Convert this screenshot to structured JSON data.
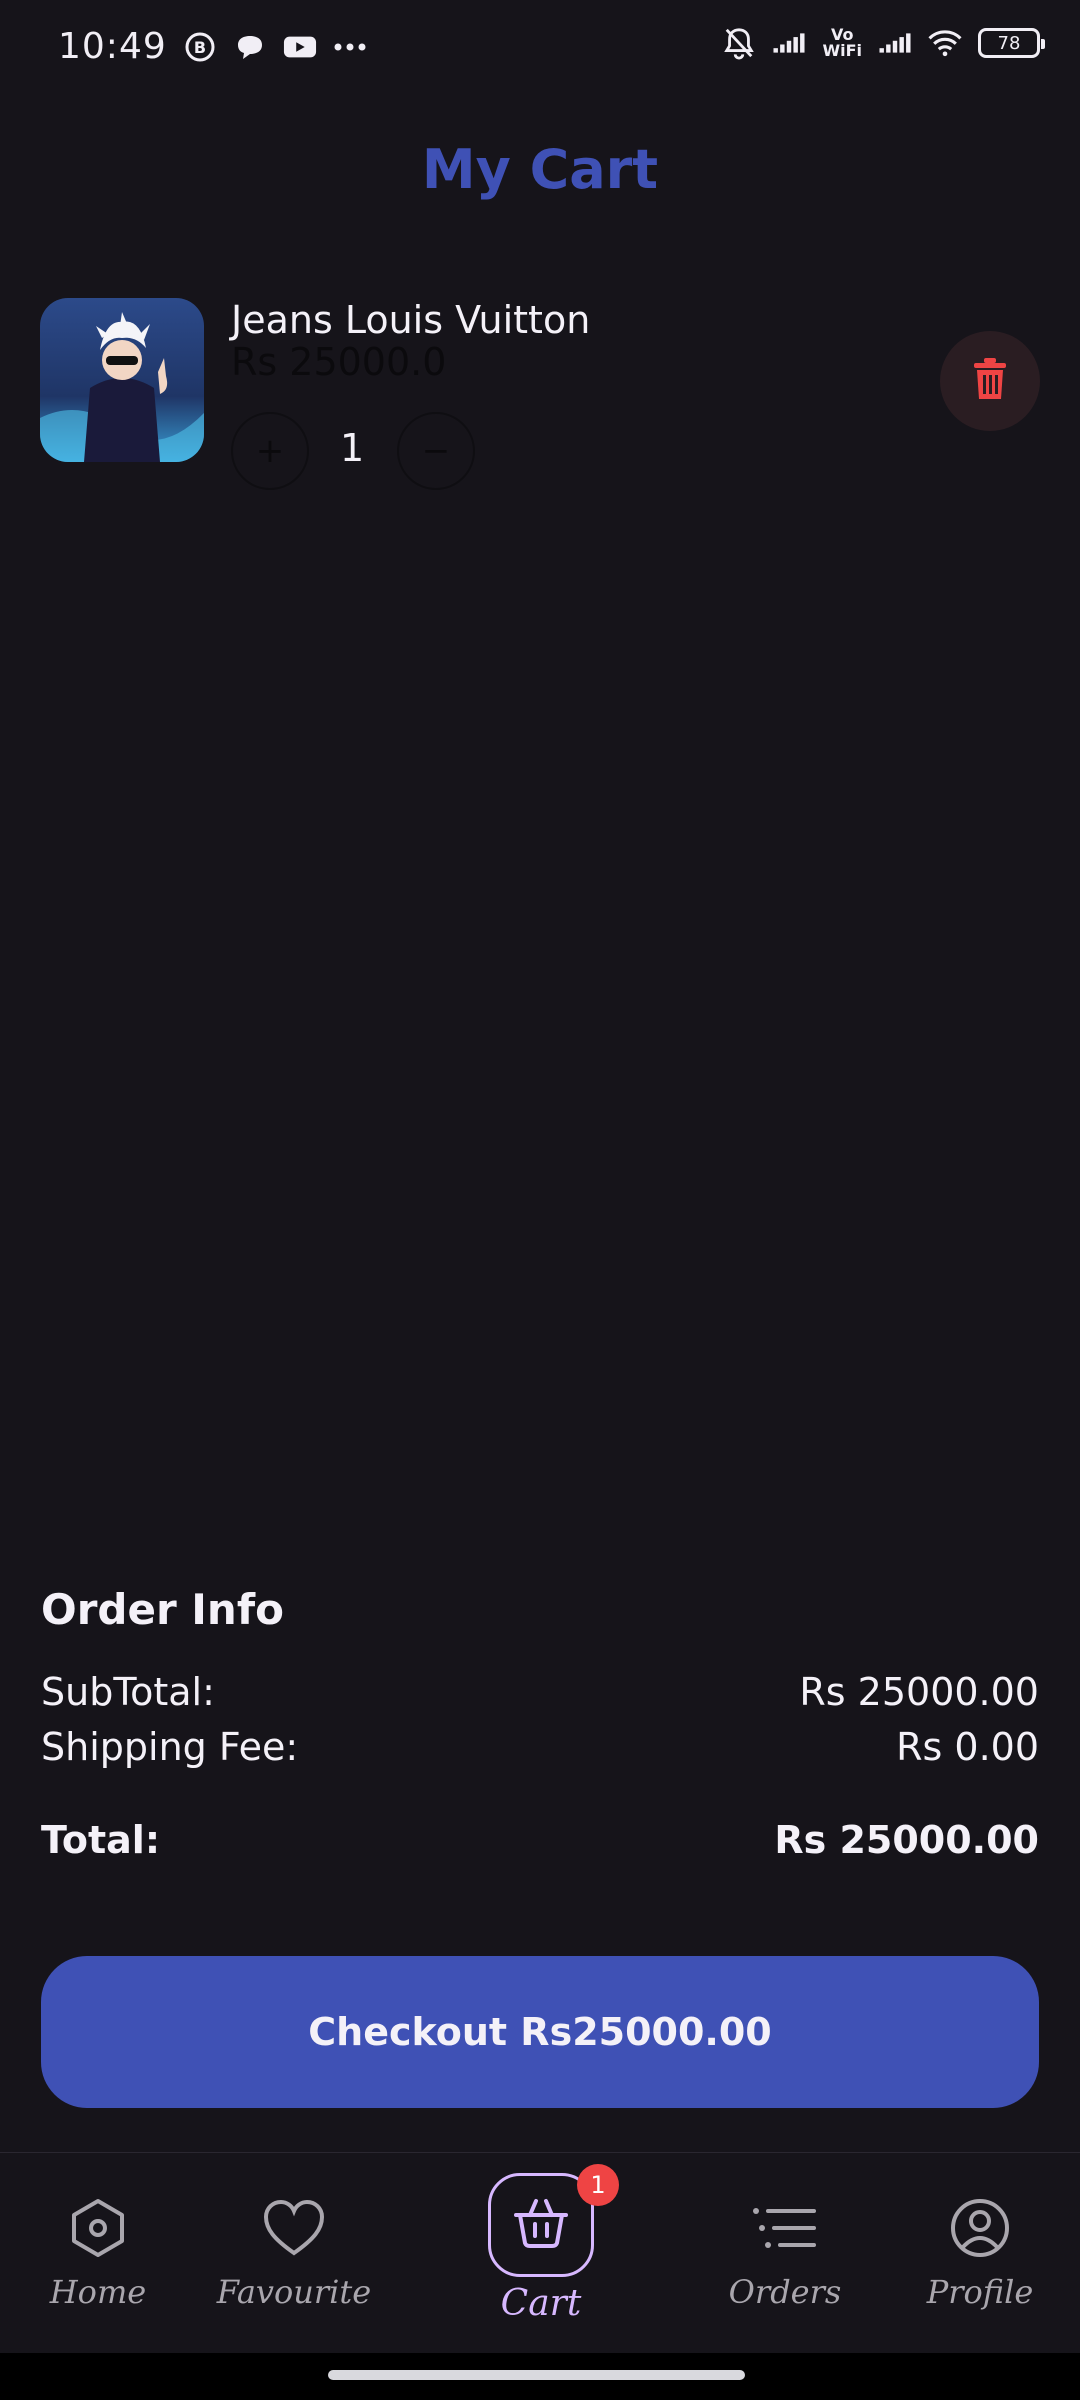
{
  "status_bar": {
    "time": "10:49",
    "battery": "78",
    "vowifi_line1": "Vo",
    "vowifi_line2": "WiFi"
  },
  "page": {
    "title": "My Cart"
  },
  "cart_item": {
    "name": "Jeans Louis Vuitton",
    "price": "Rs 25000.0",
    "quantity": "1",
    "plus_symbol": "+",
    "minus_symbol": "−"
  },
  "order_info": {
    "title": "Order Info",
    "subtotal_label": "SubTotal:",
    "subtotal_value": "Rs 25000.00",
    "shipping_label": "Shipping Fee:",
    "shipping_value": "Rs 0.00",
    "total_label": "Total:",
    "total_value": "Rs 25000.00"
  },
  "checkout": {
    "label": "Checkout Rs25000.00"
  },
  "nav": {
    "home": "Home",
    "favourite": "Favourite",
    "cart": "Cart",
    "cart_badge": "1",
    "orders": "Orders",
    "profile": "Profile"
  },
  "colors": {
    "accent": "#3f51b5",
    "background": "#16141a",
    "cart_highlight": "#d7b8ff",
    "delete_red": "#ef4444"
  }
}
